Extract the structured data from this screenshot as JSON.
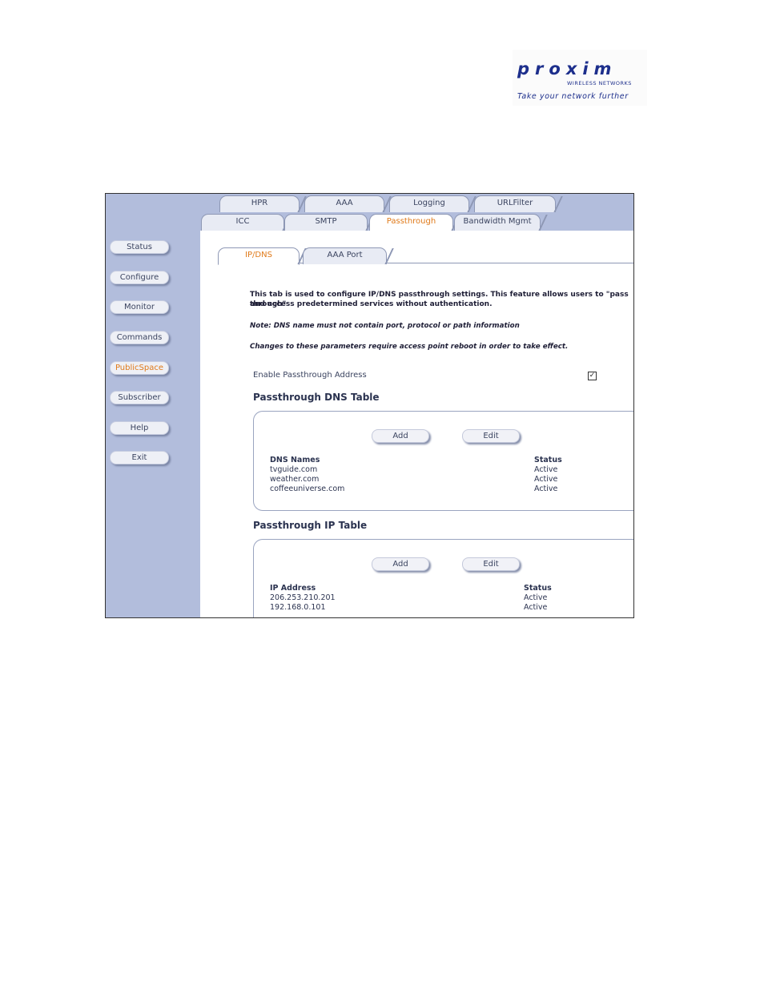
{
  "logo": {
    "brand": "proxim",
    "subtitle": "WIRELESS NETWORKS",
    "tagline": "Take your network further"
  },
  "sidebar": {
    "items": [
      {
        "label": "Status"
      },
      {
        "label": "Configure"
      },
      {
        "label": "Monitor"
      },
      {
        "label": "Commands"
      },
      {
        "label": "PublicSpace",
        "active": true
      },
      {
        "label": "Subscriber"
      },
      {
        "label": "Help"
      },
      {
        "label": "Exit"
      }
    ]
  },
  "tabs_row1": [
    "HPR",
    "AAA",
    "Logging",
    "URLFilter"
  ],
  "tabs_row2": [
    "ICC",
    "SMTP",
    "Passthrough",
    "Bandwidth Mgmt"
  ],
  "active_tab": "Passthrough",
  "subtabs": [
    "IP/DNS",
    "AAA Port"
  ],
  "active_subtab": "IP/DNS",
  "content": {
    "intro_line1": "This tab is used to configure IP/DNS passthrough settings. This feature allows users to \"pass through\"",
    "intro_line2": "and access predetermined services without authentication.",
    "note": "Note: DNS name must not contain port, protocol or path information",
    "changes": "Changes to these parameters require access point reboot in order to take effect.",
    "enable_label": "Enable Passthrough Address",
    "enable_checked": true,
    "check_mark": "✓"
  },
  "dns_table": {
    "title": "Passthrough DNS Table",
    "add_label": "Add",
    "edit_label": "Edit",
    "col_name": "DNS Names",
    "col_status": "Status",
    "rows": [
      {
        "name": "tvguide.com",
        "status": "Active"
      },
      {
        "name": "weather.com",
        "status": "Active"
      },
      {
        "name": "coffeeuniverse.com",
        "status": "Active"
      }
    ]
  },
  "ip_table": {
    "title": "Passthrough IP Table",
    "add_label": "Add",
    "edit_label": "Edit",
    "col_name": "IP Address",
    "col_status": "Status",
    "rows": [
      {
        "name": "206.253.210.201",
        "status": "Active"
      },
      {
        "name": "192.168.0.101",
        "status": "Active"
      }
    ]
  },
  "colors": {
    "sidebar_bg": "#b2bddc",
    "accent": "#e07a1a",
    "text": "#2b3350"
  }
}
